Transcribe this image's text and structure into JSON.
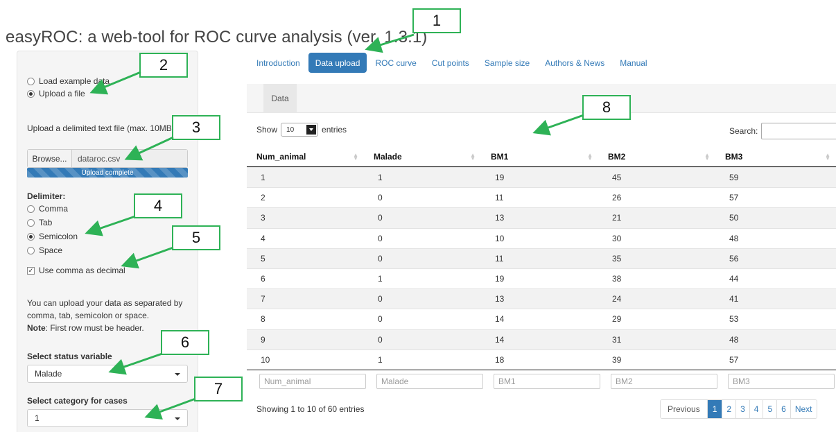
{
  "app": {
    "title": "easyROC: a web-tool for ROC curve analysis (ver. 1.3.1)"
  },
  "sidebar": {
    "source_options": [
      "Load example data",
      "Upload a file"
    ],
    "source_selected": "Upload a file",
    "upload_label": "Upload a delimited text file (max. 10MB):",
    "browse_label": "Browse...",
    "file_name": "dataroc.csv",
    "upload_status": "Upload complete",
    "upload_progress": 1.0,
    "delimiter_label": "Delimiter:",
    "delimiters": [
      "Comma",
      "Tab",
      "Semicolon",
      "Space"
    ],
    "delimiter_selected": "Semicolon",
    "decimal_label": "Use comma as decimal",
    "decimal_checked": true,
    "help_text": "You can upload your data as separated by comma, tab, semicolon or space.",
    "note_label": "Note",
    "note_text": ": First row must be header.",
    "status_label": "Select status variable",
    "status_value": "Malade",
    "category_label": "Select category for cases",
    "category_value": "1"
  },
  "nav": {
    "tabs": [
      "Introduction",
      "Data upload",
      "ROC curve",
      "Cut points",
      "Sample size",
      "Authors & News",
      "Manual"
    ],
    "active": "Data upload"
  },
  "panel": {
    "tab_label": "Data"
  },
  "datatable": {
    "show_label": "Show",
    "entries_label": "entries",
    "page_length": "10",
    "search_label": "Search:",
    "columns": [
      "Num_animal",
      "Malade",
      "BM1",
      "BM2",
      "BM3"
    ],
    "rows": [
      [
        "1",
        "1",
        "19",
        "45",
        "59"
      ],
      [
        "2",
        "0",
        "11",
        "26",
        "57"
      ],
      [
        "3",
        "0",
        "13",
        "21",
        "50"
      ],
      [
        "4",
        "0",
        "10",
        "30",
        "48"
      ],
      [
        "5",
        "0",
        "11",
        "35",
        "56"
      ],
      [
        "6",
        "1",
        "19",
        "38",
        "44"
      ],
      [
        "7",
        "0",
        "13",
        "24",
        "41"
      ],
      [
        "8",
        "0",
        "14",
        "29",
        "53"
      ],
      [
        "9",
        "0",
        "14",
        "31",
        "48"
      ],
      [
        "10",
        "1",
        "18",
        "39",
        "57"
      ]
    ],
    "filter_placeholders": [
      "Num_animal",
      "Malade",
      "BM1",
      "BM2",
      "BM3"
    ],
    "info": "Showing 1 to 10 of 60 entries",
    "pager": {
      "previous": "Previous",
      "pages": [
        "1",
        "2",
        "3",
        "4",
        "5",
        "6"
      ],
      "active_page": "1",
      "next": "Next"
    }
  },
  "annotations": {
    "labels": [
      "1",
      "2",
      "3",
      "4",
      "5",
      "6",
      "7",
      "8"
    ],
    "color": "#2eb256"
  }
}
